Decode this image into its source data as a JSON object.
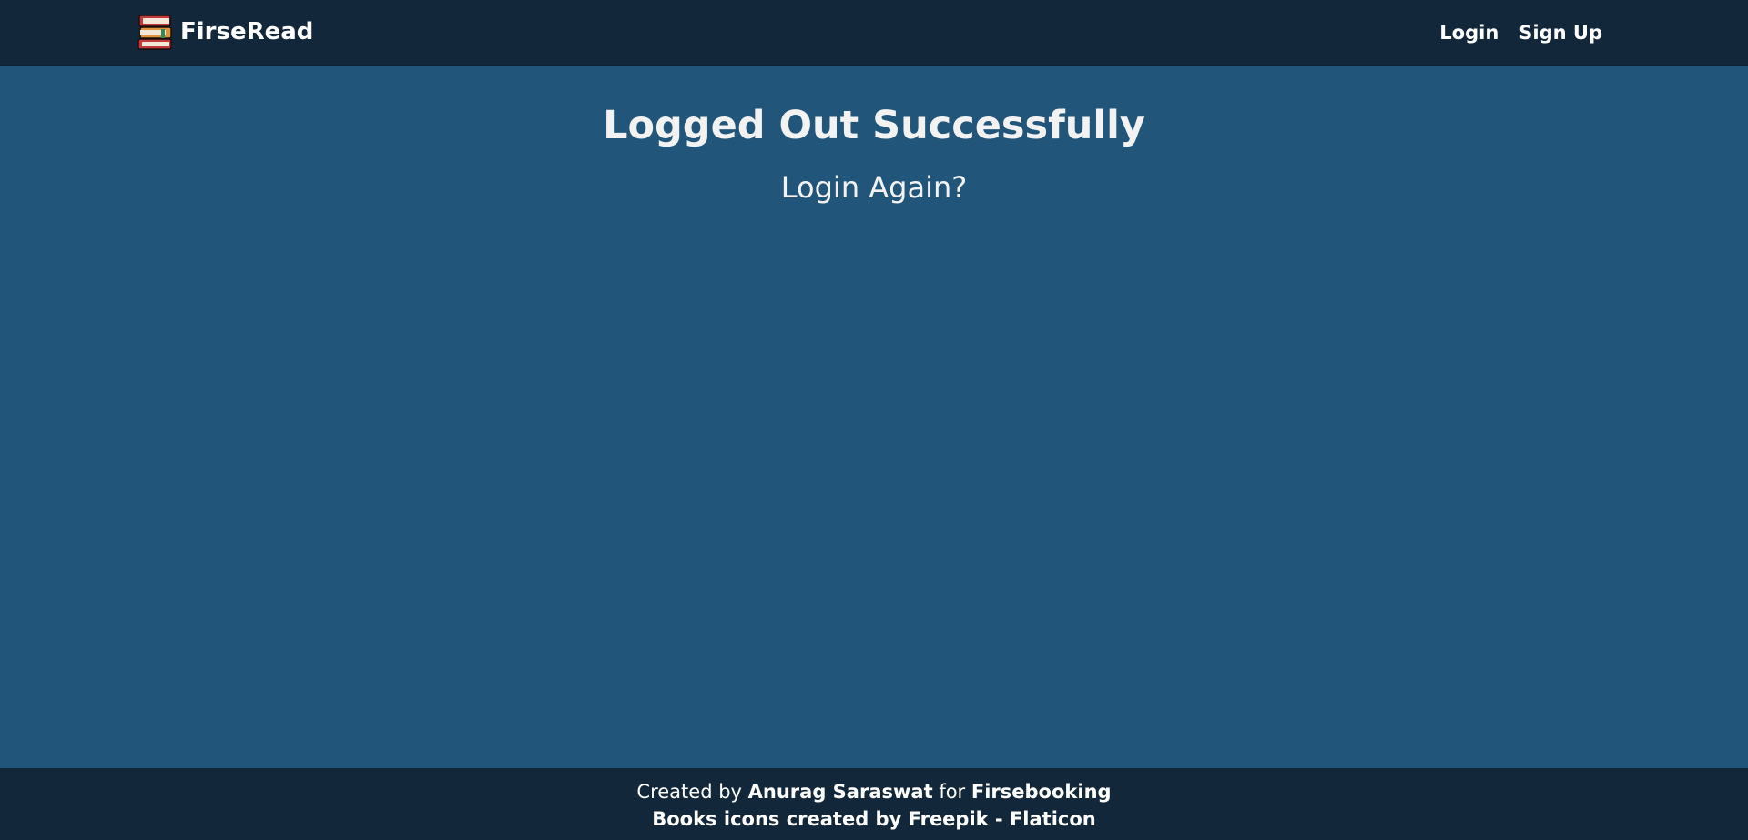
{
  "navbar": {
    "brand_name": "FirseRead",
    "brand_icon": "books-stack-icon",
    "links": {
      "login": "Login",
      "signup": "Sign Up"
    }
  },
  "main": {
    "title": "Logged Out Successfully",
    "login_again": "Login Again?"
  },
  "footer": {
    "created_by_prefix": "Created by",
    "author": "Anurag Saraswat",
    "for_text": "for",
    "org": "Firsebooking",
    "attribution": "Books icons created by Freepik - Flaticon"
  },
  "colors": {
    "navbar_bg": "#13273b",
    "page_bg": "#21557a",
    "text": "#ffffff"
  }
}
